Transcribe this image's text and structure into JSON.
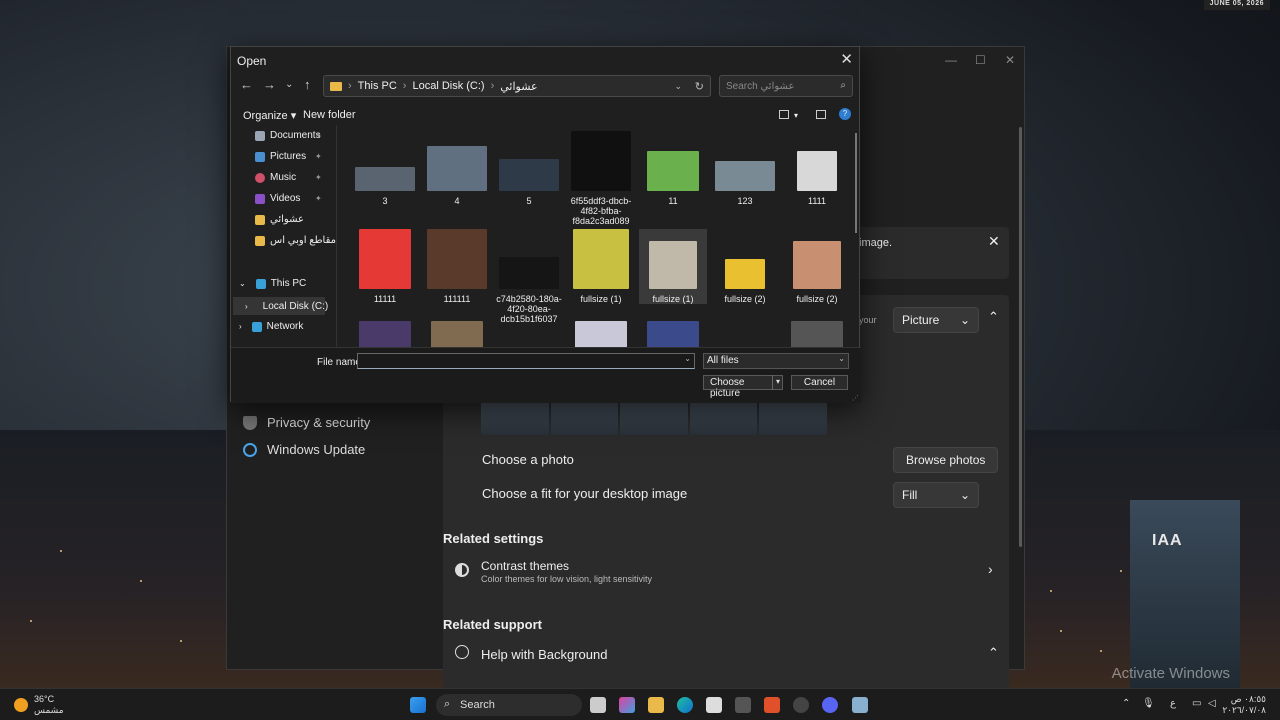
{
  "desktop": {
    "top_date": "JUNE 05, 2026",
    "building_sign": "IAA",
    "watermark": "Activate Windows"
  },
  "settings": {
    "nav": [
      {
        "label": "Privacy & security"
      },
      {
        "label": "Windows Update"
      }
    ],
    "tip_text": "image.",
    "background_row": {
      "label_fragment": "your",
      "value": "Picture"
    },
    "choose_photo": {
      "label": "Choose a photo",
      "button": "Browse photos"
    },
    "fit": {
      "label": "Choose a fit for your desktop image",
      "value": "Fill"
    },
    "related_settings": {
      "heading": "Related settings",
      "title": "Contrast themes",
      "subtitle": "Color themes for low vision, light sensitivity"
    },
    "related_support": {
      "heading": "Related support",
      "title": "Help with Background"
    }
  },
  "dialog": {
    "title": "Open",
    "breadcrumb": [
      "This PC",
      "Local Disk (C:)",
      "عشوائي"
    ],
    "search_placeholder": "Search عشوائي",
    "toolbar": {
      "organize": "Organize",
      "new_folder": "New folder"
    },
    "sidebar": [
      {
        "label": "Documents"
      },
      {
        "label": "Pictures"
      },
      {
        "label": "Music"
      },
      {
        "label": "Videos"
      },
      {
        "label": "عشوائي"
      },
      {
        "label": "مقاطع اوبي اس"
      },
      {
        "label": "This PC"
      },
      {
        "label": "Local Disk (C:)"
      },
      {
        "label": "Network"
      }
    ],
    "files": [
      {
        "name": "3",
        "color": "#5a6470"
      },
      {
        "name": "4",
        "color": "#607080"
      },
      {
        "name": "5",
        "color": "#2e3a48"
      },
      {
        "name": "6f55ddf3-dbcb-4f82-bfba-f8da2c3ad089",
        "color": "#101010"
      },
      {
        "name": "11",
        "color": "#6ab04c"
      },
      {
        "name": "123",
        "color": "#7a8a94"
      },
      {
        "name": "1111",
        "color": "#d8d8d8"
      },
      {
        "name": "11111",
        "color": "#e53935"
      },
      {
        "name": "111111",
        "color": "#5a3a2a"
      },
      {
        "name": "c74b2580-180a-4f20-80ea-dcb15b1f6037",
        "color": "#151515"
      },
      {
        "name": "fullsize (1)",
        "color": "#c8c040"
      },
      {
        "name": "fullsize (1)",
        "color": "#c0b8a8"
      },
      {
        "name": "fullsize (2)",
        "color": "#e8c030"
      },
      {
        "name": "fullsize (2)",
        "color": "#c89070"
      }
    ],
    "file_name_label": "File name:",
    "file_name_value": "",
    "file_type": "All files",
    "choose_button": "Choose picture",
    "cancel_button": "Cancel"
  },
  "taskbar": {
    "temperature": "36°C",
    "weather": "مشمس",
    "search": "Search",
    "lang": "ع",
    "time": "٠٨:٥٥ ص",
    "date": "٢٠٢٦/٠٧/٠٨"
  }
}
